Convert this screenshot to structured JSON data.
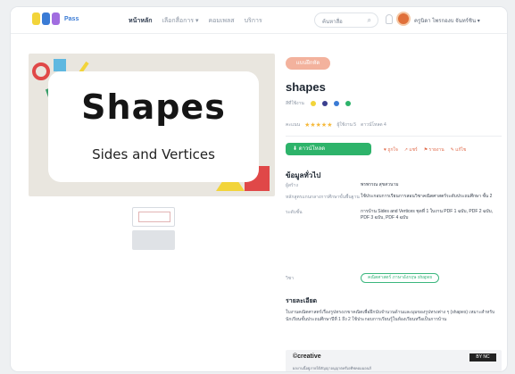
{
  "header": {
    "logo_text": "Pass",
    "nav": [
      "หน้าหลัก",
      "เลือกสื่อการ ▾",
      "คอมเพลส",
      "บริการ"
    ],
    "search_placeholder": "ค้นหาสื่อ",
    "username": "ครูนิดา ไพรกองบ จันทร์ชิน ▾"
  },
  "preview": {
    "title": "Shapes",
    "subtitle": "Sides and Vertices"
  },
  "detail": {
    "tag": "แบบฝึกหัด",
    "title": "shapes",
    "colors_label": "สีที่ใช้งาน",
    "colors": [
      "#f2d43a",
      "#3b3f8f",
      "#3a7bd5",
      "#2db36a"
    ],
    "rating_label": "คะแนน",
    "stars": "★★★★★",
    "downloads": "ผู้ใช้งาน 5",
    "views": "ดาวน์โหลด 4",
    "download_button": "ดาวน์โหลด",
    "actions": [
      "♥ ถูกใจ",
      "↗ แชร์",
      "⚑ รายงาน",
      "✎ แก้ไข"
    ],
    "info_title": "ข้อมูลทั่วไป",
    "info": [
      {
        "k": "ผู้สร้าง",
        "v": "พรพรรณ สุขสวนาม"
      },
      {
        "k": "หลักสูตรแกนกลางการศึกษาขั้นพื้นฐาน",
        "v": "ใช้ประกอบการเรียนการสอนวิชาคณิตศาสตร์ระดับประถมศึกษา ชั้น 2"
      },
      {
        "k": "ระดับชั้น",
        "v": "การบ้าน Sides and Vertices ชุดที่ 1 ใบงาน PDF 1 ฉบับ, PDF 2 ฉบับ, PDF 3 ฉบับ, PDF 4 ฉบับ"
      }
    ],
    "tag_label": "วิชา",
    "chip": "คณิตศาสตร์ ภาษาอังกฤษ shapes",
    "desc_title": "รายละเอียด",
    "description": "ใบงานคณิตศาสตร์เรื่องรูปทรงเรขาคณิตเพื่อฝึกนับจำนวนด้านและมุมของรูปทรงต่าง ๆ (shapes) เหมาะสำหรับนักเรียนชั้นประถมศึกษาปีที่ 1 ถึง 2 ใช้ประกอบการเรียนรู้ในห้องเรียนหรือเป็นการบ้าน",
    "cc": "©creative",
    "cc_badge": "BY NC",
    "license": "ผลงานนี้อยู่ภายใต้สัญญาอนุญาตครีเอทีฟคอมมอนส์"
  }
}
